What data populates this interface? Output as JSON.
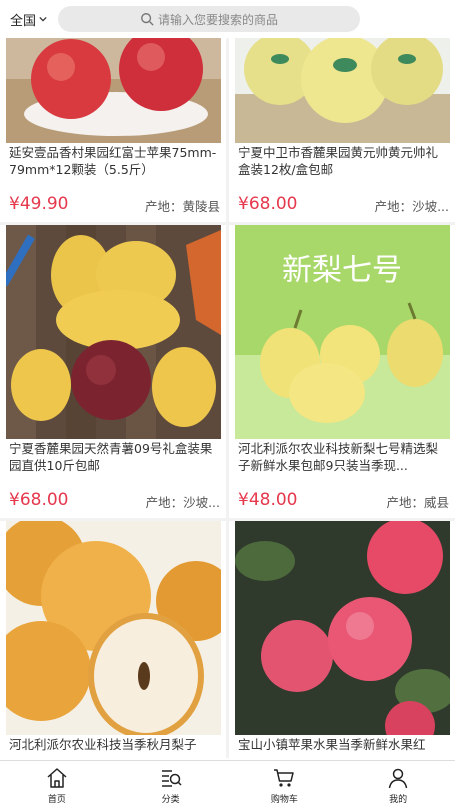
{
  "header": {
    "region": "全国",
    "search_placeholder": "请输入您要搜索的商品"
  },
  "products": [
    {
      "title": "延安壹品香村果园红富士苹果75mm-79mm*12颗装（5.5斤）",
      "price": "¥49.90",
      "origin": "产地：黄陵县",
      "image": "red-apples-photo"
    },
    {
      "title": "宁夏中卫市香麓果园黄元帅黄元帅礼盒装12枚/盒包邮",
      "price": "¥68.00",
      "origin": "产地：沙坡...",
      "image": "yellow-apples-photo"
    },
    {
      "title": "宁夏香麓果园天然青薯09号礼盒装果园直供10斤包邮",
      "price": "¥68.00",
      "origin": "产地：沙坡...",
      "image": "potatoes-photo"
    },
    {
      "title": "河北利派尔农业科技新梨七号精选梨子新鲜水果包邮9只装当季现...",
      "price": "¥48.00",
      "origin": "产地：威县",
      "image": "pears-photo",
      "image_text": "新梨七号"
    },
    {
      "title": "河北利派尔农业科技当季秋月梨子",
      "price": "",
      "origin": "",
      "image": "autumn-pears-photo"
    },
    {
      "title": "宝山小镇苹果水果当季新鲜水果红",
      "price": "",
      "origin": "",
      "image": "tree-apples-photo"
    }
  ],
  "tabbar": {
    "items": [
      {
        "label": "首页",
        "icon": "home-icon"
      },
      {
        "label": "分类",
        "icon": "category-icon"
      },
      {
        "label": "购物车",
        "icon": "cart-icon"
      },
      {
        "label": "我的",
        "icon": "user-icon"
      }
    ]
  },
  "colors": {
    "price": "#e5384d",
    "search_bg": "#e9e9e9"
  }
}
